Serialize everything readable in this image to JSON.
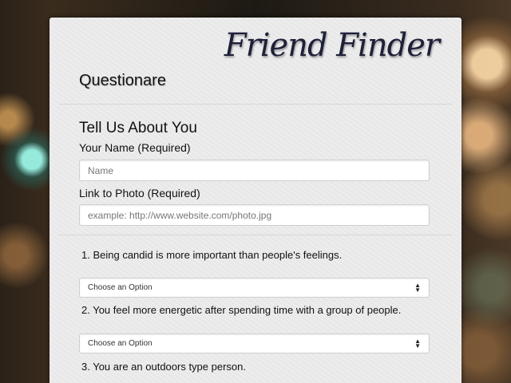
{
  "brand": "Friend Finder",
  "page_title": "Questionare",
  "section_title": "Tell Us About You",
  "name_field": {
    "label": "Your Name (Required)",
    "placeholder": "Name",
    "value": ""
  },
  "photo_field": {
    "label": "Link to Photo (Required)",
    "placeholder": "example: http://www.website.com/photo.jpg",
    "value": ""
  },
  "questions": [
    {
      "text": "1. Being candid is more important than people's feelings.",
      "selected": "Choose an Option"
    },
    {
      "text": "2. You feel more energetic after spending time with a group of people.",
      "selected": "Choose an Option"
    },
    {
      "text": "3. You are an outdoors type person.",
      "selected": ""
    }
  ],
  "icons": {
    "select_arrows": "sort-arrows-icon"
  }
}
